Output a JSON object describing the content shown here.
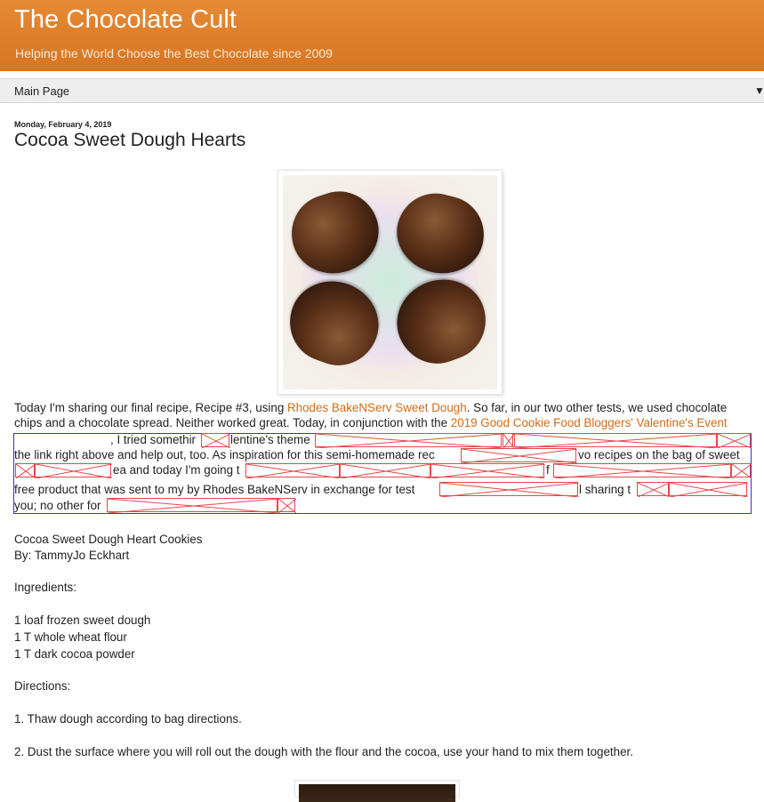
{
  "blog": {
    "title": "The Chocolate Cult",
    "description": "Helping the World Choose the Best Chocolate since 2009"
  },
  "nav": {
    "item": "Main Page",
    "dropdown_glyph": "▼"
  },
  "post": {
    "date": "Monday, February 4, 2019",
    "title": "Cocoa Sweet Dough Hearts",
    "intro": {
      "p1": "Today I'm sharing our final recipe, Recipe #3, using ",
      "link1": "Rhodes BakeNServ Sweet Dough",
      "p2": ". So far, in our two other tests, we used chocolate chips and a chocolate spread. Neither worked great. Today, in conjunction with the ",
      "link2": "2019 Good Cookie Food Bloggers' Valentine's Event",
      "frag1": ", I tried somethir",
      "frag2": "lentine's theme",
      "frag3": "the link right above and help out, too. As inspiration for this semi-homemade rec",
      "frag4": "vo recipes on the bag of sweet",
      "frag5": "ea and today I'm going t",
      "frag6": "f",
      "frag7": "free product that was sent to my by Rhodes BakeNServ in exchange for test",
      "frag8": "l sharing t",
      "frag9": "you; no other for"
    },
    "recipe_title": "Cocoa Sweet Dough Heart Cookies",
    "byline": "By: TammyJo Eckhart",
    "ingredients_heading": "Ingredients:",
    "ingredients": [
      "1 loaf frozen sweet dough",
      "1 T whole wheat flour",
      "1 T dark cocoa powder"
    ],
    "directions_heading": "Directions:",
    "directions": [
      "1. Thaw dough according to bag directions.",
      "2. Dust the surface where you will roll out the dough with the flour and the cocoa, use your hand to mix them together."
    ]
  },
  "colors": {
    "header": "#e0802f",
    "link": "#d26b17",
    "broken_image_border": "#e8474a",
    "iframe_border": "#3333cc"
  }
}
